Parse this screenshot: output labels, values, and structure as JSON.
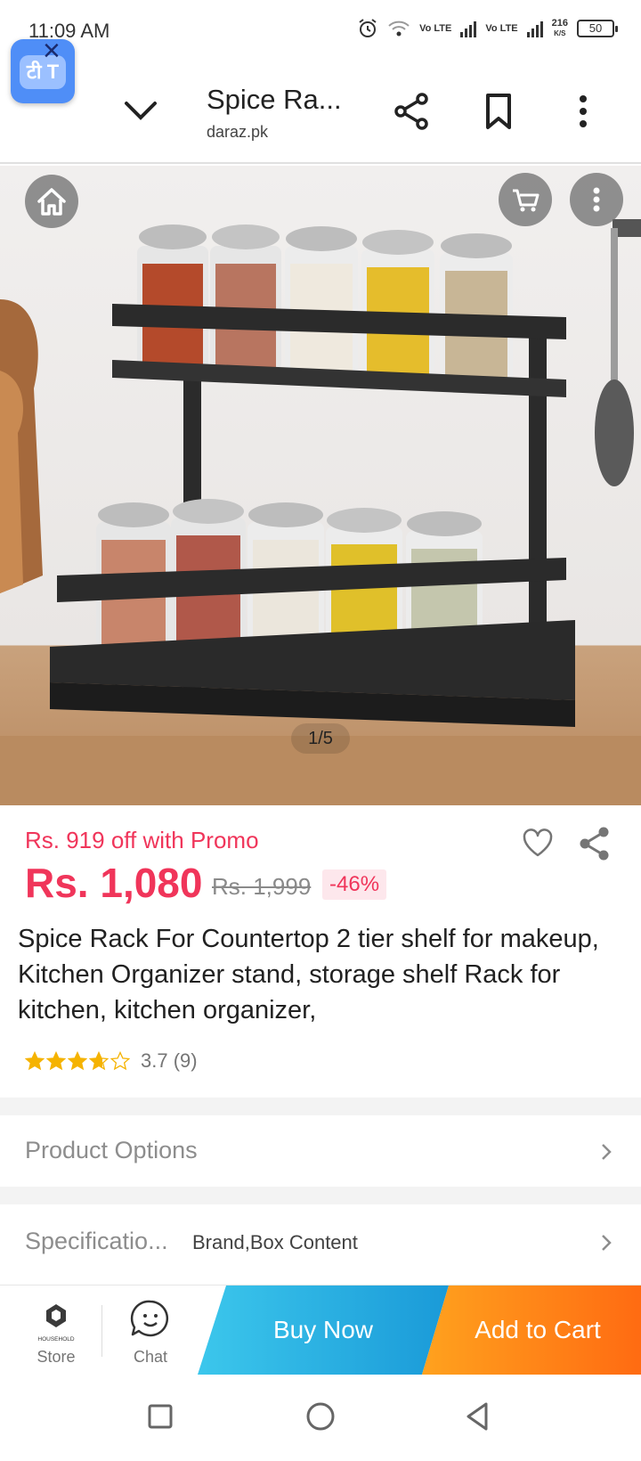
{
  "status_bar": {
    "time": "11:09 AM",
    "net1": "Vo LTE",
    "net2": "Vo LTE",
    "speed": "216",
    "speed_unit": "K/S",
    "battery": "50"
  },
  "browser": {
    "page_title": "Spice Ra...",
    "domain": "daraz.pk",
    "translate_glyph": "टी T"
  },
  "gallery": {
    "counter": "1/5"
  },
  "product": {
    "promo": "Rs. 919 off with Promo",
    "price": "Rs. 1,080",
    "old_price": "Rs. 1,999",
    "discount": "-46%",
    "title": "Spice Rack For Countertop 2 tier shelf for makeup, Kitchen Organizer stand, storage shelf Rack for kitchen, kitchen organizer,",
    "rating_text": "3.7 (9)",
    "rating_value": 3.7,
    "rating_max": 5
  },
  "sections": {
    "options_label": "Product Options",
    "spec_label": "Specificatio...",
    "spec_value": "Brand,Box Content"
  },
  "action_bar": {
    "store_logo_text": "HOUSEHOLD",
    "store_label": "Store",
    "chat_label": "Chat",
    "buy_now": "Buy Now",
    "add_to_cart": "Add to Cart"
  },
  "colors": {
    "accent_red": "#f0355a",
    "buy_now": "#1a9ad8",
    "add_to_cart": "#ff6b12",
    "star": "#f5b301"
  }
}
